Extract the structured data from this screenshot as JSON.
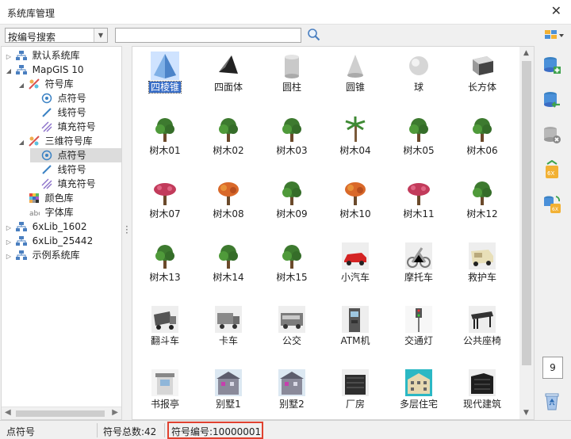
{
  "window": {
    "title": "系统库管理",
    "close_glyph": "✕"
  },
  "toolbar": {
    "search_mode": "按编号搜索",
    "search_value": ""
  },
  "tree": {
    "nodes": [
      {
        "label": "默认系统库",
        "icon": "library-icon"
      },
      {
        "label": "MapGIS 10",
        "icon": "library-icon"
      },
      {
        "label": "符号库",
        "icon": "symbol-lib-icon"
      },
      {
        "label": "点符号",
        "icon": "point-symbol-icon"
      },
      {
        "label": "线符号",
        "icon": "line-symbol-icon"
      },
      {
        "label": "填充符号",
        "icon": "fill-symbol-icon"
      },
      {
        "label": "三维符号库",
        "icon": "symbol-lib-icon"
      },
      {
        "label": "点符号",
        "icon": "point-symbol-icon"
      },
      {
        "label": "线符号",
        "icon": "line-symbol-icon"
      },
      {
        "label": "填充符号",
        "icon": "fill-symbol-icon"
      },
      {
        "label": "颜色库",
        "icon": "color-lib-icon"
      },
      {
        "label": "字体库",
        "icon": "font-lib-icon"
      },
      {
        "label": "6xLib_1602",
        "icon": "library-icon"
      },
      {
        "label": "6xLib_25442",
        "icon": "library-icon"
      },
      {
        "label": "示例系统库",
        "icon": "library-icon"
      }
    ]
  },
  "symbols": [
    {
      "label": "四棱锥",
      "icon": "pyramid-icon"
    },
    {
      "label": "四面体",
      "icon": "tetrahedron-icon"
    },
    {
      "label": "圆柱",
      "icon": "cylinder-icon"
    },
    {
      "label": "圆锥",
      "icon": "cone-icon"
    },
    {
      "label": "球",
      "icon": "sphere-icon"
    },
    {
      "label": "长方体",
      "icon": "cuboid-icon"
    },
    {
      "label": "树木01",
      "icon": "tree-icon"
    },
    {
      "label": "树木02",
      "icon": "tree-icon"
    },
    {
      "label": "树木03",
      "icon": "tree-icon"
    },
    {
      "label": "树木04",
      "icon": "palm-tree-icon"
    },
    {
      "label": "树木05",
      "icon": "tree-icon"
    },
    {
      "label": "树木06",
      "icon": "tree-icon"
    },
    {
      "label": "树木07",
      "icon": "flower-tree-icon"
    },
    {
      "label": "树木08",
      "icon": "autumn-tree-icon"
    },
    {
      "label": "树木09",
      "icon": "tree-icon"
    },
    {
      "label": "树木10",
      "icon": "autumn-tree-icon"
    },
    {
      "label": "树木11",
      "icon": "flower-tree-icon"
    },
    {
      "label": "树木12",
      "icon": "tree-icon"
    },
    {
      "label": "树木13",
      "icon": "tree-icon"
    },
    {
      "label": "树木14",
      "icon": "tree-icon"
    },
    {
      "label": "树木15",
      "icon": "tree-icon"
    },
    {
      "label": "小汽车",
      "icon": "car-icon"
    },
    {
      "label": "摩托车",
      "icon": "motorcycle-icon"
    },
    {
      "label": "救护车",
      "icon": "ambulance-icon"
    },
    {
      "label": "翻斗车",
      "icon": "dump-truck-icon"
    },
    {
      "label": "卡车",
      "icon": "truck-icon"
    },
    {
      "label": "公交",
      "icon": "bus-icon"
    },
    {
      "label": "ATM机",
      "icon": "atm-icon"
    },
    {
      "label": "交通灯",
      "icon": "traffic-light-icon"
    },
    {
      "label": "公共座椅",
      "icon": "bench-icon"
    },
    {
      "label": "书报亭",
      "icon": "newsstand-icon"
    },
    {
      "label": "别墅1",
      "icon": "villa-icon"
    },
    {
      "label": "别墅2",
      "icon": "villa-icon"
    },
    {
      "label": "厂房",
      "icon": "factory-icon"
    },
    {
      "label": "多层住宅",
      "icon": "residential-icon"
    },
    {
      "label": "现代建筑",
      "icon": "modern-building-icon"
    }
  ],
  "pager": {
    "page": "9"
  },
  "status": {
    "type": "点符号",
    "total": "符号总数:42",
    "code": "符号编号:10000001"
  },
  "colors": {
    "selection": "#3a6fc8",
    "highlight_border": "#e0412f"
  }
}
